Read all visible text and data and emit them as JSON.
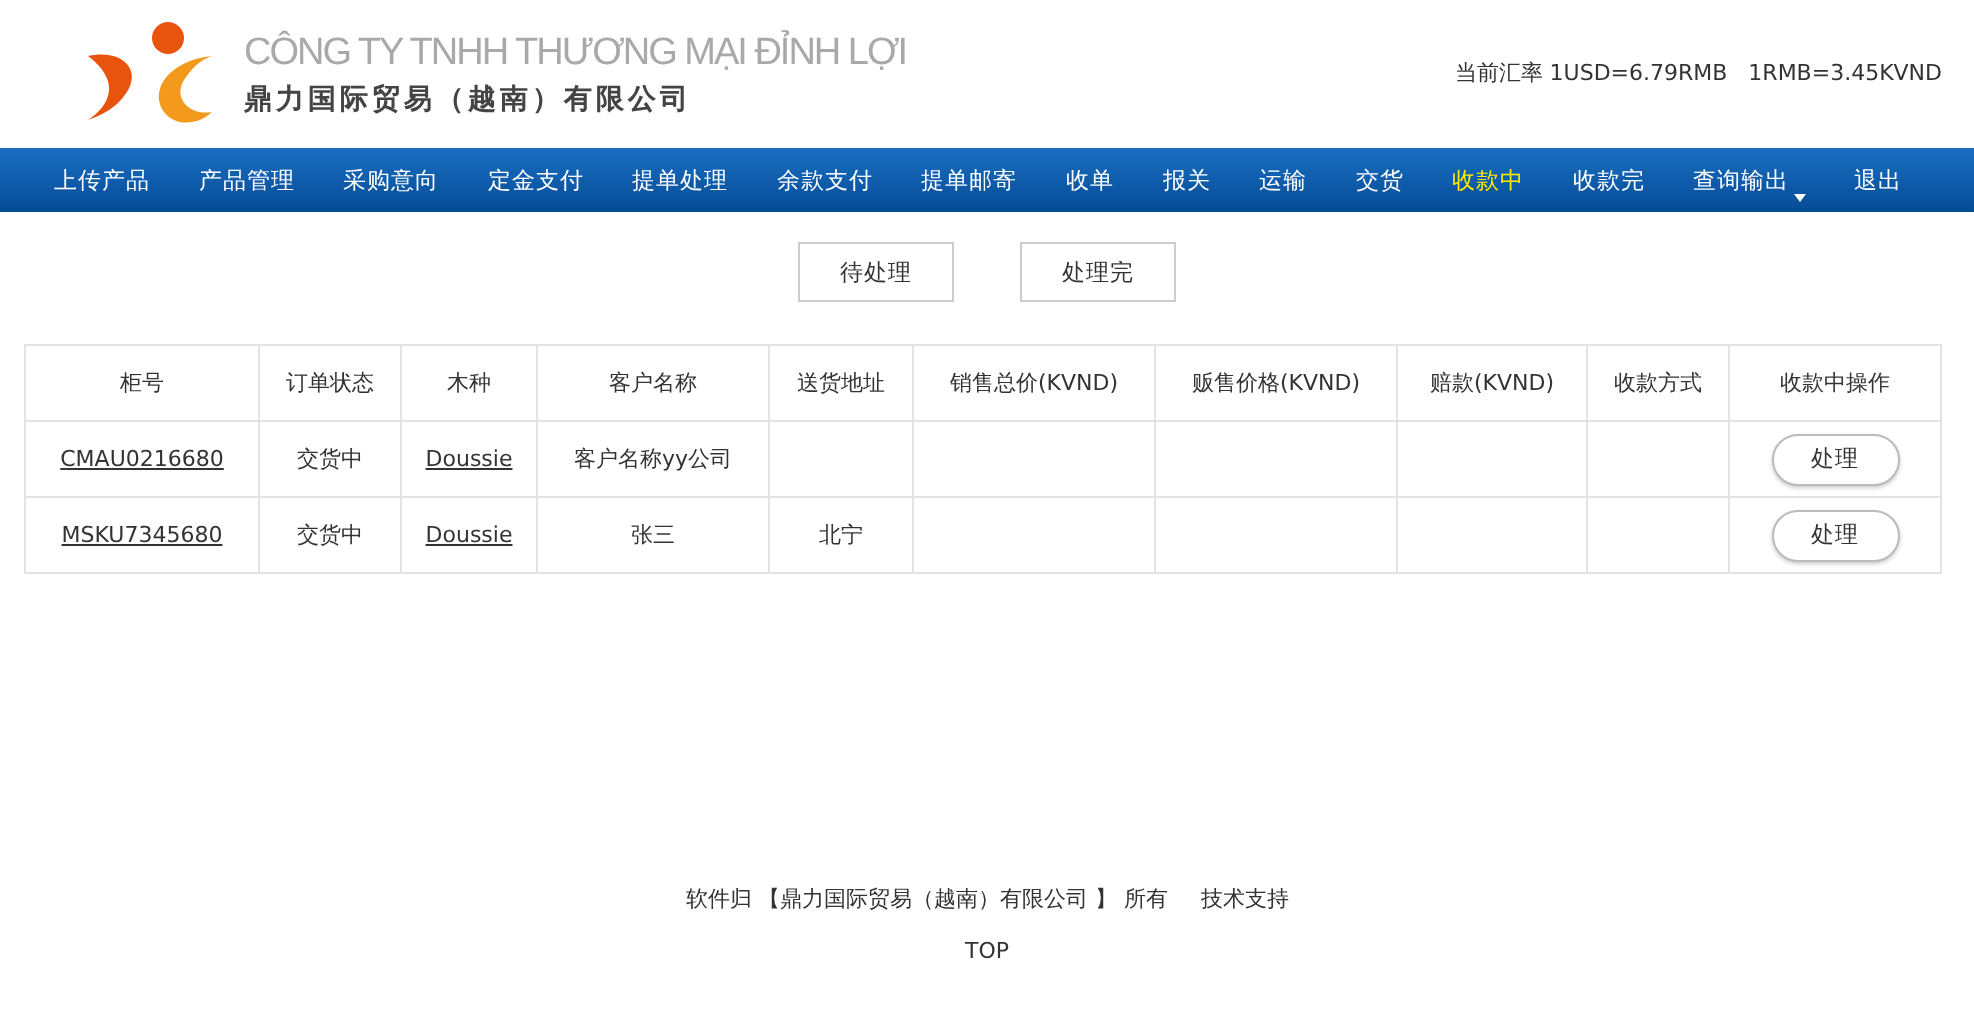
{
  "header": {
    "company_name": "CÔNG TY TNHH THƯƠNG MẠI ĐỈNH LỢI",
    "company_name_cn": "鼎力国际贸易（越南）有限公司",
    "exchange_rate": "当前汇率 1USD=6.79RMB   1RMB=3.45KVND"
  },
  "nav": [
    {
      "label": "上传产品",
      "selected": false
    },
    {
      "label": "产品管理",
      "selected": false
    },
    {
      "label": "采购意向",
      "selected": false
    },
    {
      "label": "定金支付",
      "selected": false
    },
    {
      "label": "提单处理",
      "selected": false
    },
    {
      "label": "余款支付",
      "selected": false
    },
    {
      "label": "提单邮寄",
      "selected": false
    },
    {
      "label": "收单",
      "selected": false
    },
    {
      "label": "报关",
      "selected": false
    },
    {
      "label": "运输",
      "selected": false
    },
    {
      "label": "交货",
      "selected": false
    },
    {
      "label": "收款中",
      "selected": true
    },
    {
      "label": "收款完",
      "selected": false
    },
    {
      "label": "查询输出",
      "selected": false,
      "dropdown": true
    },
    {
      "label": "退出",
      "selected": false
    }
  ],
  "filters": [
    {
      "label": "待处理"
    },
    {
      "label": "处理完"
    }
  ],
  "table": {
    "columns": [
      "柜号",
      "订单状态",
      "木种",
      "客户名称",
      "送货地址",
      "销售总价(KVND)",
      "贩售价格(KVND)",
      "赔款(KVND)",
      "收款方式",
      "收款中操作"
    ],
    "rows": [
      {
        "container_no": "CMAU0216680",
        "order_status": "交货中",
        "wood_type": "Doussie",
        "customer_name": "客户名称yy公司",
        "action": "处理"
      },
      {
        "container_no": "MSKU7345680",
        "order_status": "交货中",
        "wood_type": "Doussie",
        "customer_name": "张三",
        "delivery_address": "北宁",
        "action": "处理"
      }
    ]
  },
  "footer": {
    "copyright": "软件归 【鼎力国际贸易（越南）有限公司 】 所有",
    "support": "技术支持",
    "top_link": "TOP"
  }
}
